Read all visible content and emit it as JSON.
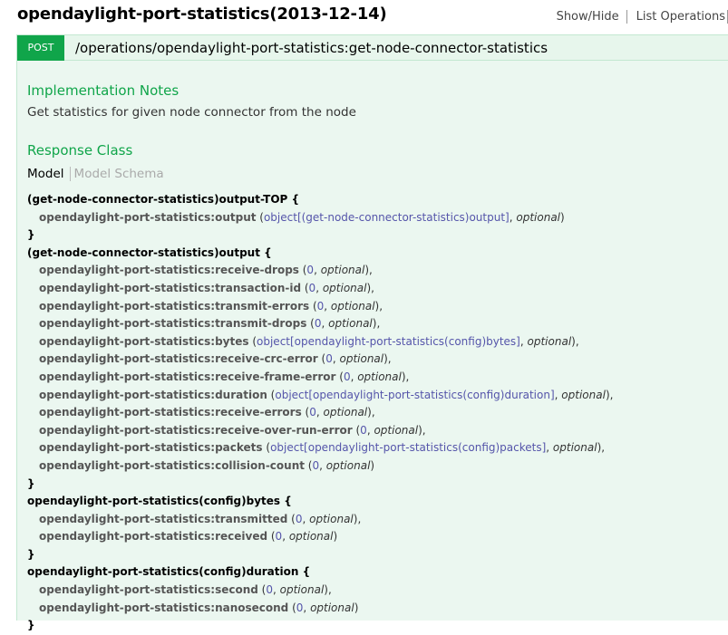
{
  "header": {
    "title": "opendaylight-port-statistics(2013-12-14)",
    "links": [
      "Show/Hide",
      "List Operations"
    ]
  },
  "operation": {
    "method": "POST",
    "path": "/operations/opendaylight-port-statistics:get-node-connector-statistics"
  },
  "implementation": {
    "heading": "Implementation Notes",
    "text": "Get statistics for given node connector from the node"
  },
  "response_class": {
    "heading": "Response Class",
    "tab_model": "Model",
    "tab_schema": "Model Schema"
  },
  "colors": {
    "accent": "#10a54a",
    "bar_bg": "#e7f6ec",
    "body_bg": "#ebf7f0",
    "type_link": "#5555aa"
  },
  "models": [
    {
      "name": "(get-node-connector-statistics)output-TOP",
      "props": [
        {
          "name": "opendaylight-port-statistics:output",
          "type": "object[(get-node-connector-statistics)output]",
          "opt": "optional",
          "last": true
        }
      ]
    },
    {
      "name": "(get-node-connector-statistics)output",
      "props": [
        {
          "name": "opendaylight-port-statistics:receive-drops",
          "type": "0",
          "opt": "optional"
        },
        {
          "name": "opendaylight-port-statistics:transaction-id",
          "type": "0",
          "opt": "optional"
        },
        {
          "name": "opendaylight-port-statistics:transmit-errors",
          "type": "0",
          "opt": "optional"
        },
        {
          "name": "opendaylight-port-statistics:transmit-drops",
          "type": "0",
          "opt": "optional"
        },
        {
          "name": "opendaylight-port-statistics:bytes",
          "type": "object[opendaylight-port-statistics(config)bytes]",
          "opt": "optional"
        },
        {
          "name": "opendaylight-port-statistics:receive-crc-error",
          "type": "0",
          "opt": "optional"
        },
        {
          "name": "opendaylight-port-statistics:receive-frame-error",
          "type": "0",
          "opt": "optional"
        },
        {
          "name": "opendaylight-port-statistics:duration",
          "type": "object[opendaylight-port-statistics(config)duration]",
          "opt": "optional"
        },
        {
          "name": "opendaylight-port-statistics:receive-errors",
          "type": "0",
          "opt": "optional"
        },
        {
          "name": "opendaylight-port-statistics:receive-over-run-error",
          "type": "0",
          "opt": "optional"
        },
        {
          "name": "opendaylight-port-statistics:packets",
          "type": "object[opendaylight-port-statistics(config)packets]",
          "opt": "optional"
        },
        {
          "name": "opendaylight-port-statistics:collision-count",
          "type": "0",
          "opt": "optional",
          "last": true
        }
      ]
    },
    {
      "name": "opendaylight-port-statistics(config)bytes",
      "props": [
        {
          "name": "opendaylight-port-statistics:transmitted",
          "type": "0",
          "opt": "optional"
        },
        {
          "name": "opendaylight-port-statistics:received",
          "type": "0",
          "opt": "optional",
          "last": true
        }
      ]
    },
    {
      "name": "opendaylight-port-statistics(config)duration",
      "props": [
        {
          "name": "opendaylight-port-statistics:second",
          "type": "0",
          "opt": "optional"
        },
        {
          "name": "opendaylight-port-statistics:nanosecond",
          "type": "0",
          "opt": "optional",
          "last": true
        }
      ]
    }
  ]
}
